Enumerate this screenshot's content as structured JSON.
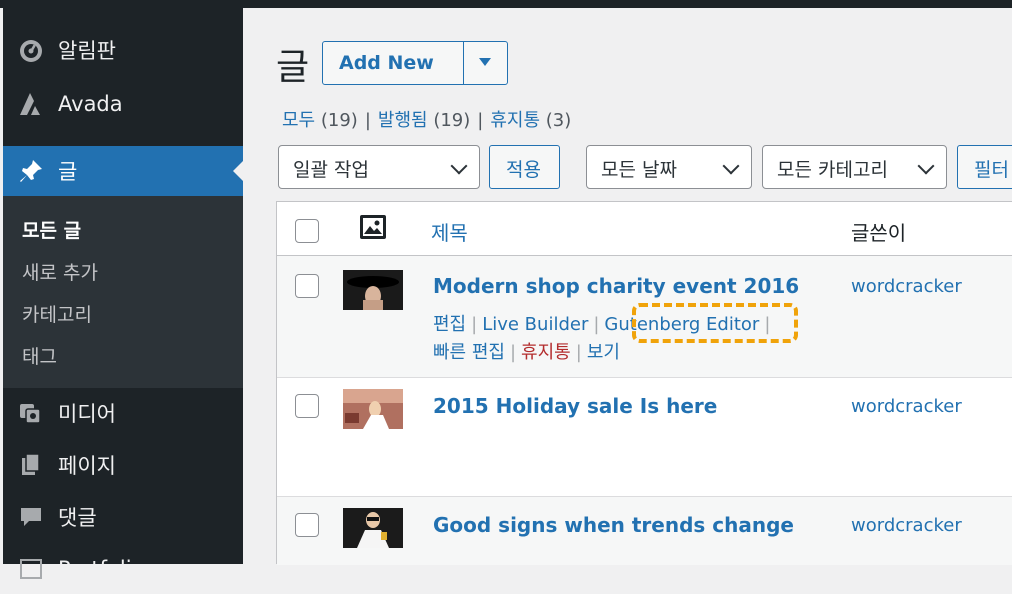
{
  "sidebar": {
    "items": [
      {
        "label": "알림판",
        "icon": "dashboard-icon"
      },
      {
        "label": "Avada",
        "icon": "avada-icon"
      },
      {
        "label": "글",
        "icon": "pin-icon"
      },
      {
        "label": "미디어",
        "icon": "media-icon"
      },
      {
        "label": "페이지",
        "icon": "page-icon"
      },
      {
        "label": "댓글",
        "icon": "comment-icon"
      },
      {
        "label": "Portfolio",
        "icon": "portfolio-icon"
      }
    ],
    "submenu": [
      "모든 글",
      "새로 추가",
      "카테고리",
      "태그"
    ]
  },
  "header": {
    "title": "글",
    "add_new": "Add New"
  },
  "filters": {
    "all": "모두",
    "all_count": "(19)",
    "published": "발행됨",
    "published_count": "(19)",
    "trash": "휴지통",
    "trash_count": "(3)",
    "separator": "|"
  },
  "toolbar": {
    "bulk_action": "일괄 작업",
    "apply": "적용",
    "all_dates": "모든 날짜",
    "all_categories": "모든 카테고리",
    "filter": "필터"
  },
  "table": {
    "columns": {
      "title": "제목",
      "author": "글쓴이"
    },
    "rows": [
      {
        "title": "Modern shop charity event 2016",
        "author": "wordcracker",
        "actions": {
          "edit": "편집",
          "live_builder": "Live Builder",
          "gutenberg": "Gutenberg Editor",
          "quick_edit": "빠른 편집",
          "trash": "휴지통",
          "view": "보기"
        }
      },
      {
        "title": "2015 Holiday sale Is here",
        "author": "wordcracker"
      },
      {
        "title": "Good signs when trends change",
        "author": "wordcracker"
      }
    ]
  },
  "colors": {
    "sidebar_bg": "#1d2327",
    "accent": "#2271b1",
    "highlight": "#f0a30a",
    "trash": "#b32d2e"
  }
}
